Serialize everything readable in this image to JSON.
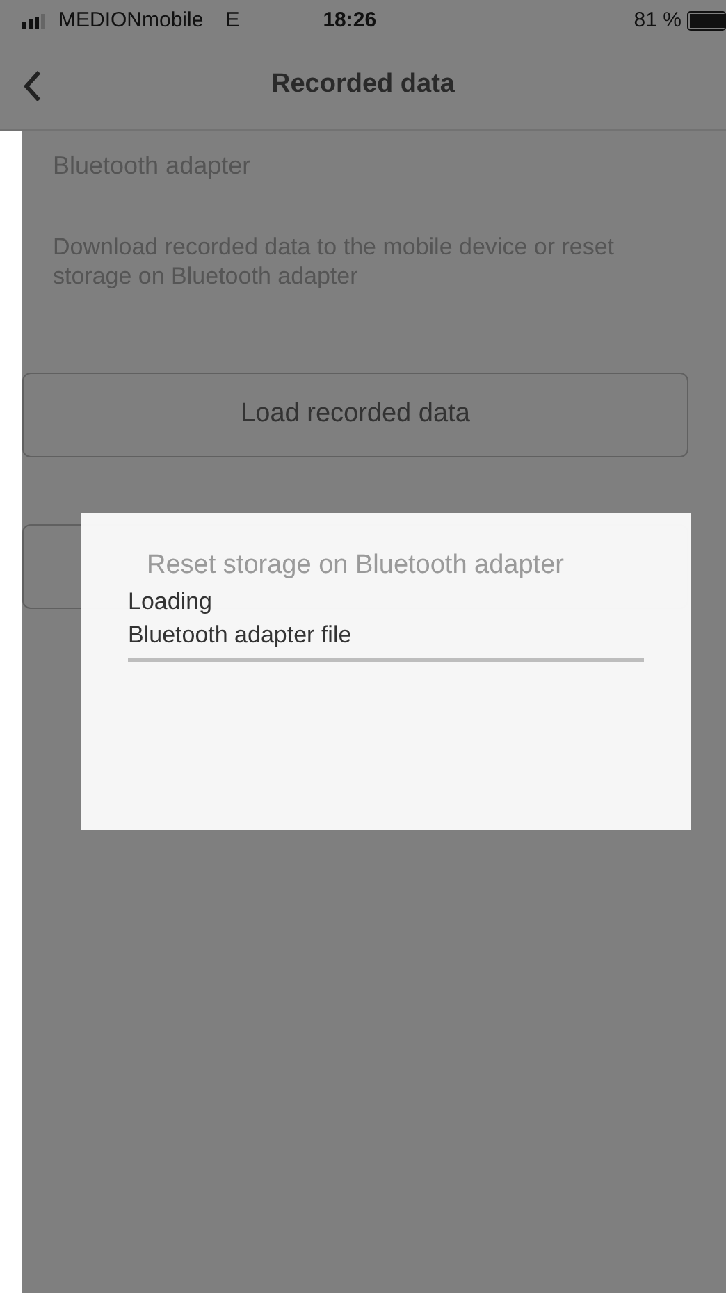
{
  "status_bar": {
    "carrier": "MEDIONmobile",
    "network": "E",
    "time": "18:26",
    "battery": "81 %"
  },
  "nav_bar": {
    "title": "Recorded data"
  },
  "section": {
    "title": "Bluetooth adapter",
    "description": "Download recorded data to the mobile device or reset storage on Bluetooth adapter"
  },
  "buttons": [
    "Load recorded data",
    "Reset storage on Bluetooth adapter"
  ],
  "dialog": {
    "title": "Loading",
    "message": "Bluetooth adapter file",
    "progress": {
      "level": 0
    }
  }
}
